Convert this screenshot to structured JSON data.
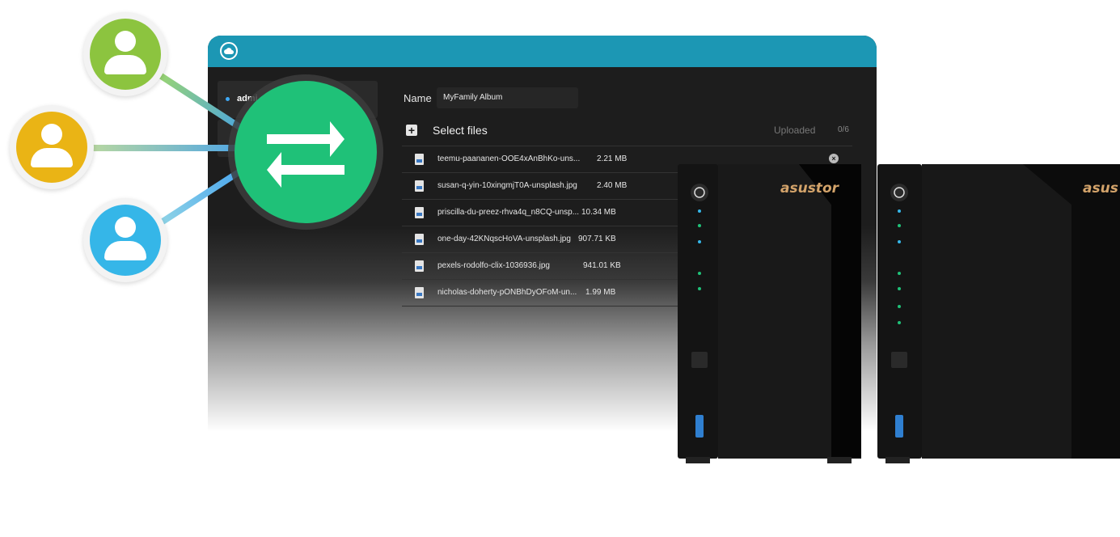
{
  "app": {
    "sidebar": {
      "items": [
        {
          "label": "admi"
        },
        {
          "label": ""
        }
      ]
    },
    "form": {
      "name_label": "Name",
      "name_value": "MyFamily Album",
      "select_files_label": "Select files",
      "uploaded_label": "Uploaded",
      "uploaded_count": "0/6"
    },
    "files": [
      {
        "name": "teemu-paananen-OOE4xAnBhKo-uns...",
        "size": "2.21 MB"
      },
      {
        "name": "susan-q-yin-10xingmjT0A-unsplash.jpg",
        "size": "2.40 MB"
      },
      {
        "name": "priscilla-du-preez-rhva4q_n8CQ-unsp...",
        "size": "10.34 MB"
      },
      {
        "name": "one-day-42KNqscHoVA-unsplash.jpg",
        "size": "907.71 KB"
      },
      {
        "name": "pexels-rodolfo-clix-1036936.jpg",
        "size": "941.01 KB"
      },
      {
        "name": "nicholas-doherty-pONBhDyOFoM-un...",
        "size": "1.99 MB"
      }
    ]
  },
  "brand": {
    "name": "asustor",
    "name_cropped": "asus"
  },
  "colors": {
    "titlebar": "#1c97b4",
    "hub": "#1fc178",
    "user_green": "#8cc43f",
    "user_yellow": "#eab415",
    "user_blue": "#35b6e8",
    "link_blue": "#3f9ff0",
    "window_bg": "#1d1d1d"
  },
  "icons": {
    "titlebar": "cloud-icon",
    "add": "plus-icon",
    "file": "image-file-icon",
    "remove": "close-circle-icon",
    "hub": "transfer-arrows-icon",
    "user": "person-icon"
  }
}
